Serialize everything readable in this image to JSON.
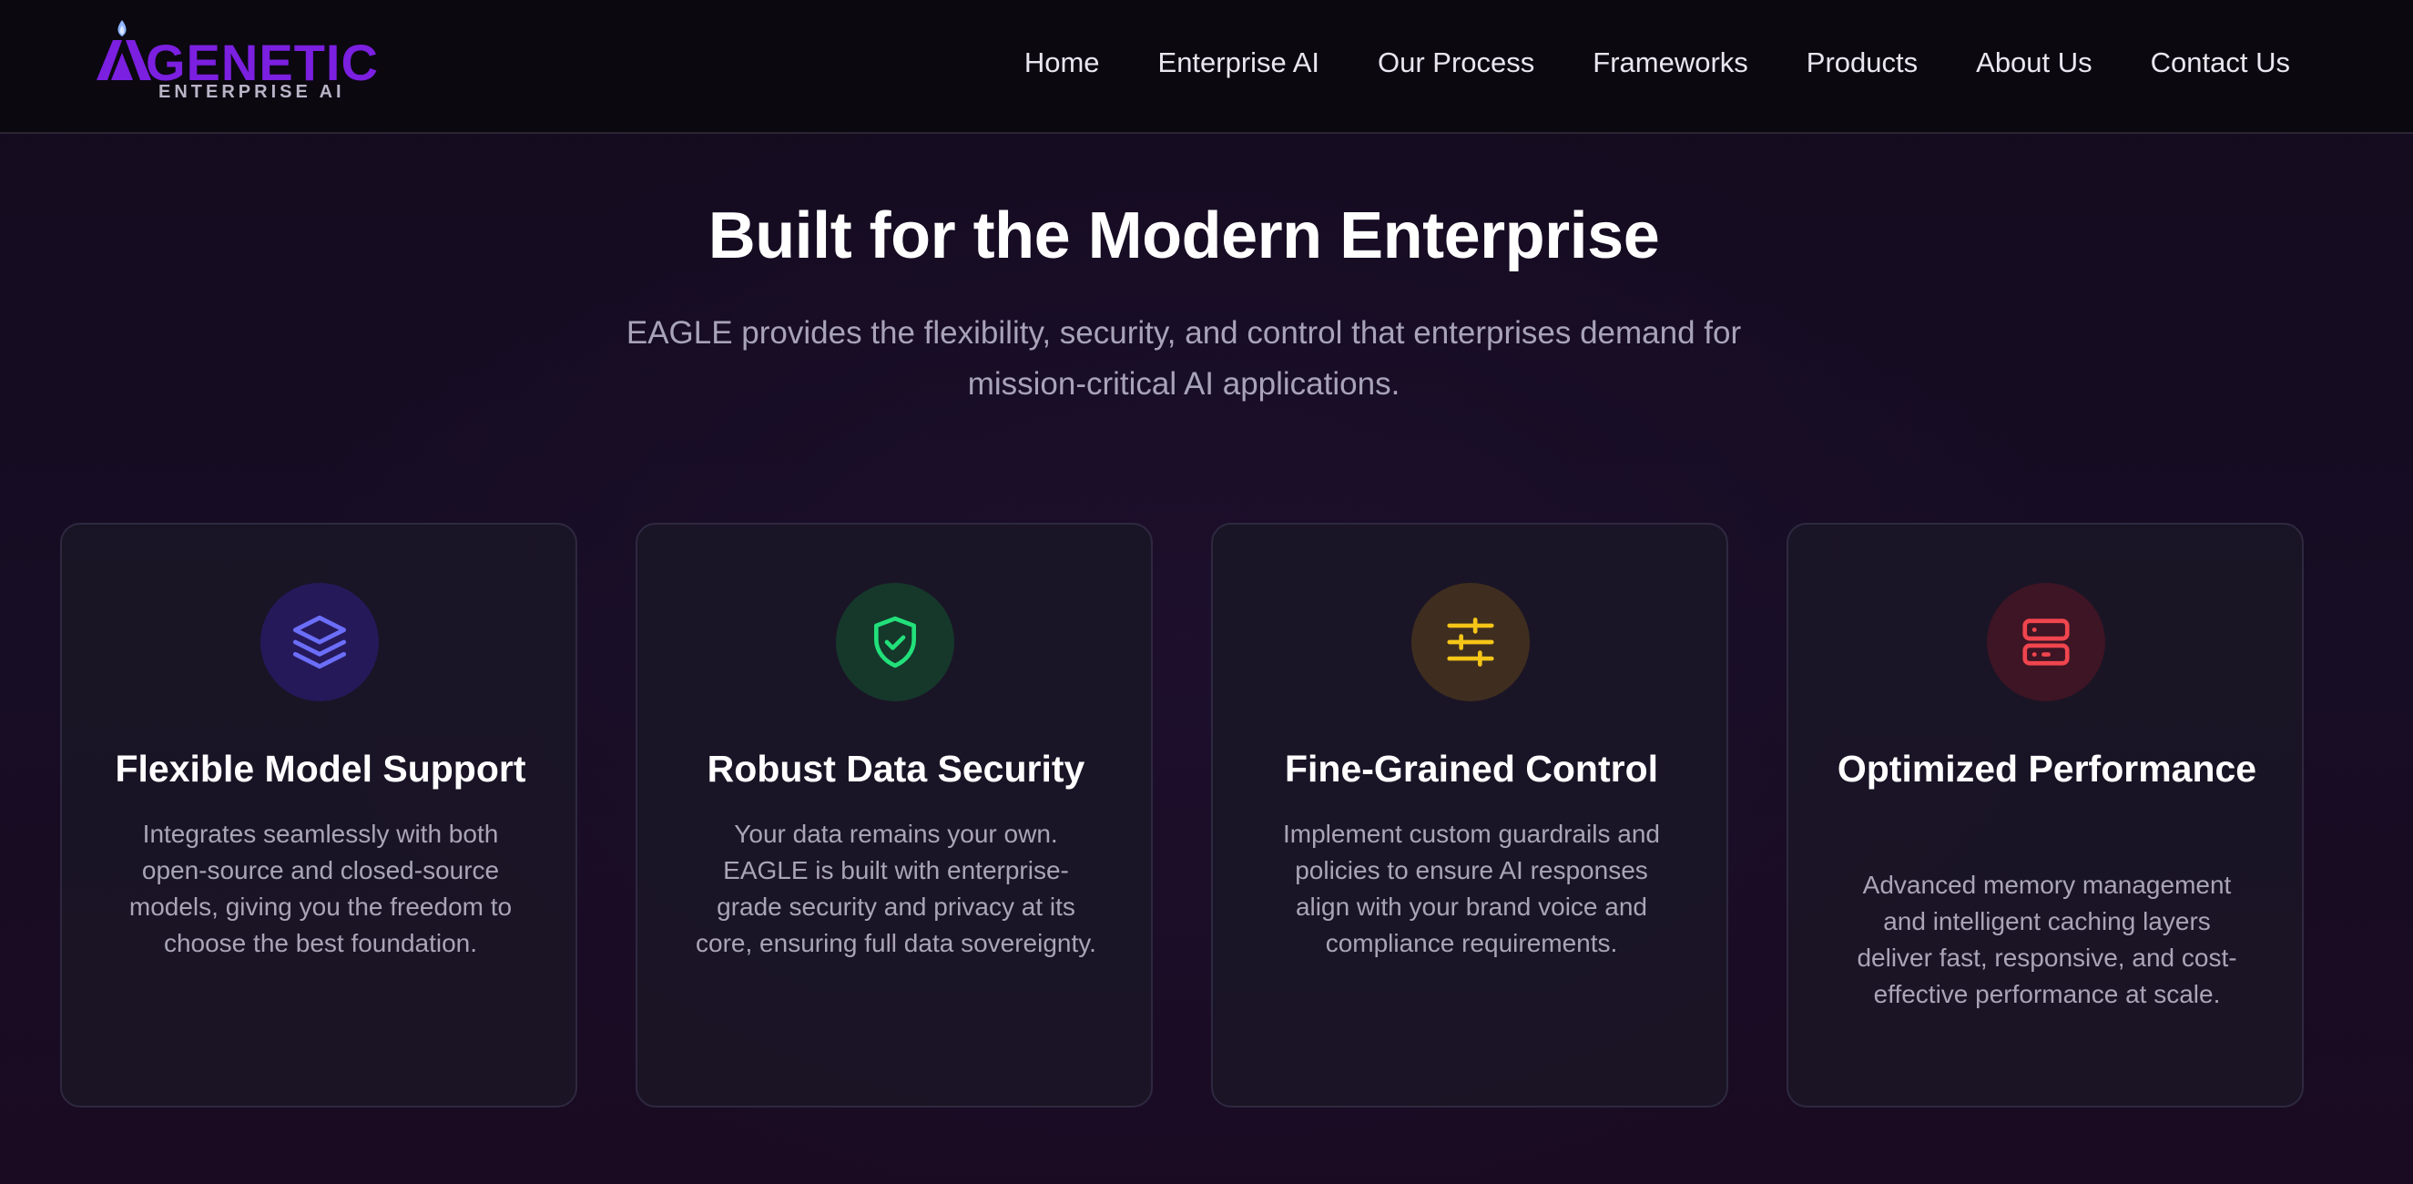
{
  "header": {
    "logo": {
      "wordmark": "GENETIC",
      "tagline": "ENTERPRISE AI",
      "brand_color": "#7b1fe0",
      "flame_color": "#8fb4ff"
    },
    "nav": [
      {
        "label": "Home"
      },
      {
        "label": "Enterprise AI"
      },
      {
        "label": "Our Process"
      },
      {
        "label": "Frameworks"
      },
      {
        "label": "Products"
      },
      {
        "label": "About Us"
      },
      {
        "label": "Contact Us"
      }
    ]
  },
  "hero": {
    "title": "Built for the Modern Enterprise",
    "subtitle": "EAGLE provides the flexibility, security, and control that enterprises demand for mission-critical AI applications."
  },
  "features": [
    {
      "icon": "layers-icon",
      "accent": "#6b6ef8",
      "circle_bg": "#25195a",
      "title": "Flexible Model Support",
      "text": "Integrates seamlessly with both open-source and closed-source models, giving you the freedom to choose the best foundation."
    },
    {
      "icon": "shield-check-icon",
      "accent": "#22e07a",
      "circle_bg": "#15382b",
      "title": "Robust Data Security",
      "text": "Your data remains your own. EAGLE is built with enterprise-grade security and privacy at its core, ensuring full data sovereignty."
    },
    {
      "icon": "sliders-icon",
      "accent": "#f5c518",
      "circle_bg": "#3f2e1f",
      "title": "Fine-Grained Control",
      "text": "Implement custom guardrails and policies to ensure AI responses align with your brand voice and compliance requirements."
    },
    {
      "icon": "server-icon",
      "accent": "#f0454e",
      "circle_bg": "#3d1524",
      "title": "Optimized Performance",
      "text": "Advanced memory management and intelligent caching layers deliver fast, responsive, and cost-effective performance at scale."
    }
  ]
}
